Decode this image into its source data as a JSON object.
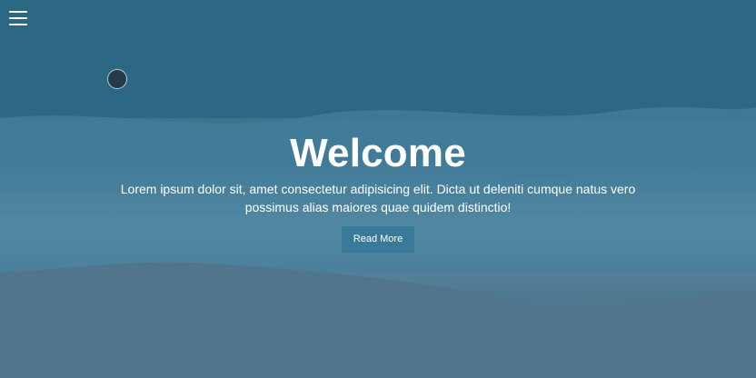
{
  "hero": {
    "title": "Welcome",
    "subtitle": "Lorem ipsum dolor sit, amet consectetur adipisicing elit. Dicta ut deleniti cumque natus vero possimus alias maiores quae quidem distinctio!",
    "button_label": "Read More"
  },
  "icons": {
    "menu": "hamburger-menu-icon"
  },
  "colors": {
    "ocean_deep": "#2f6f8b",
    "ocean_foam": "#5a8ca6",
    "sand_shadow": "#557a92",
    "button": "#3a7a99",
    "text": "#ffffff"
  }
}
